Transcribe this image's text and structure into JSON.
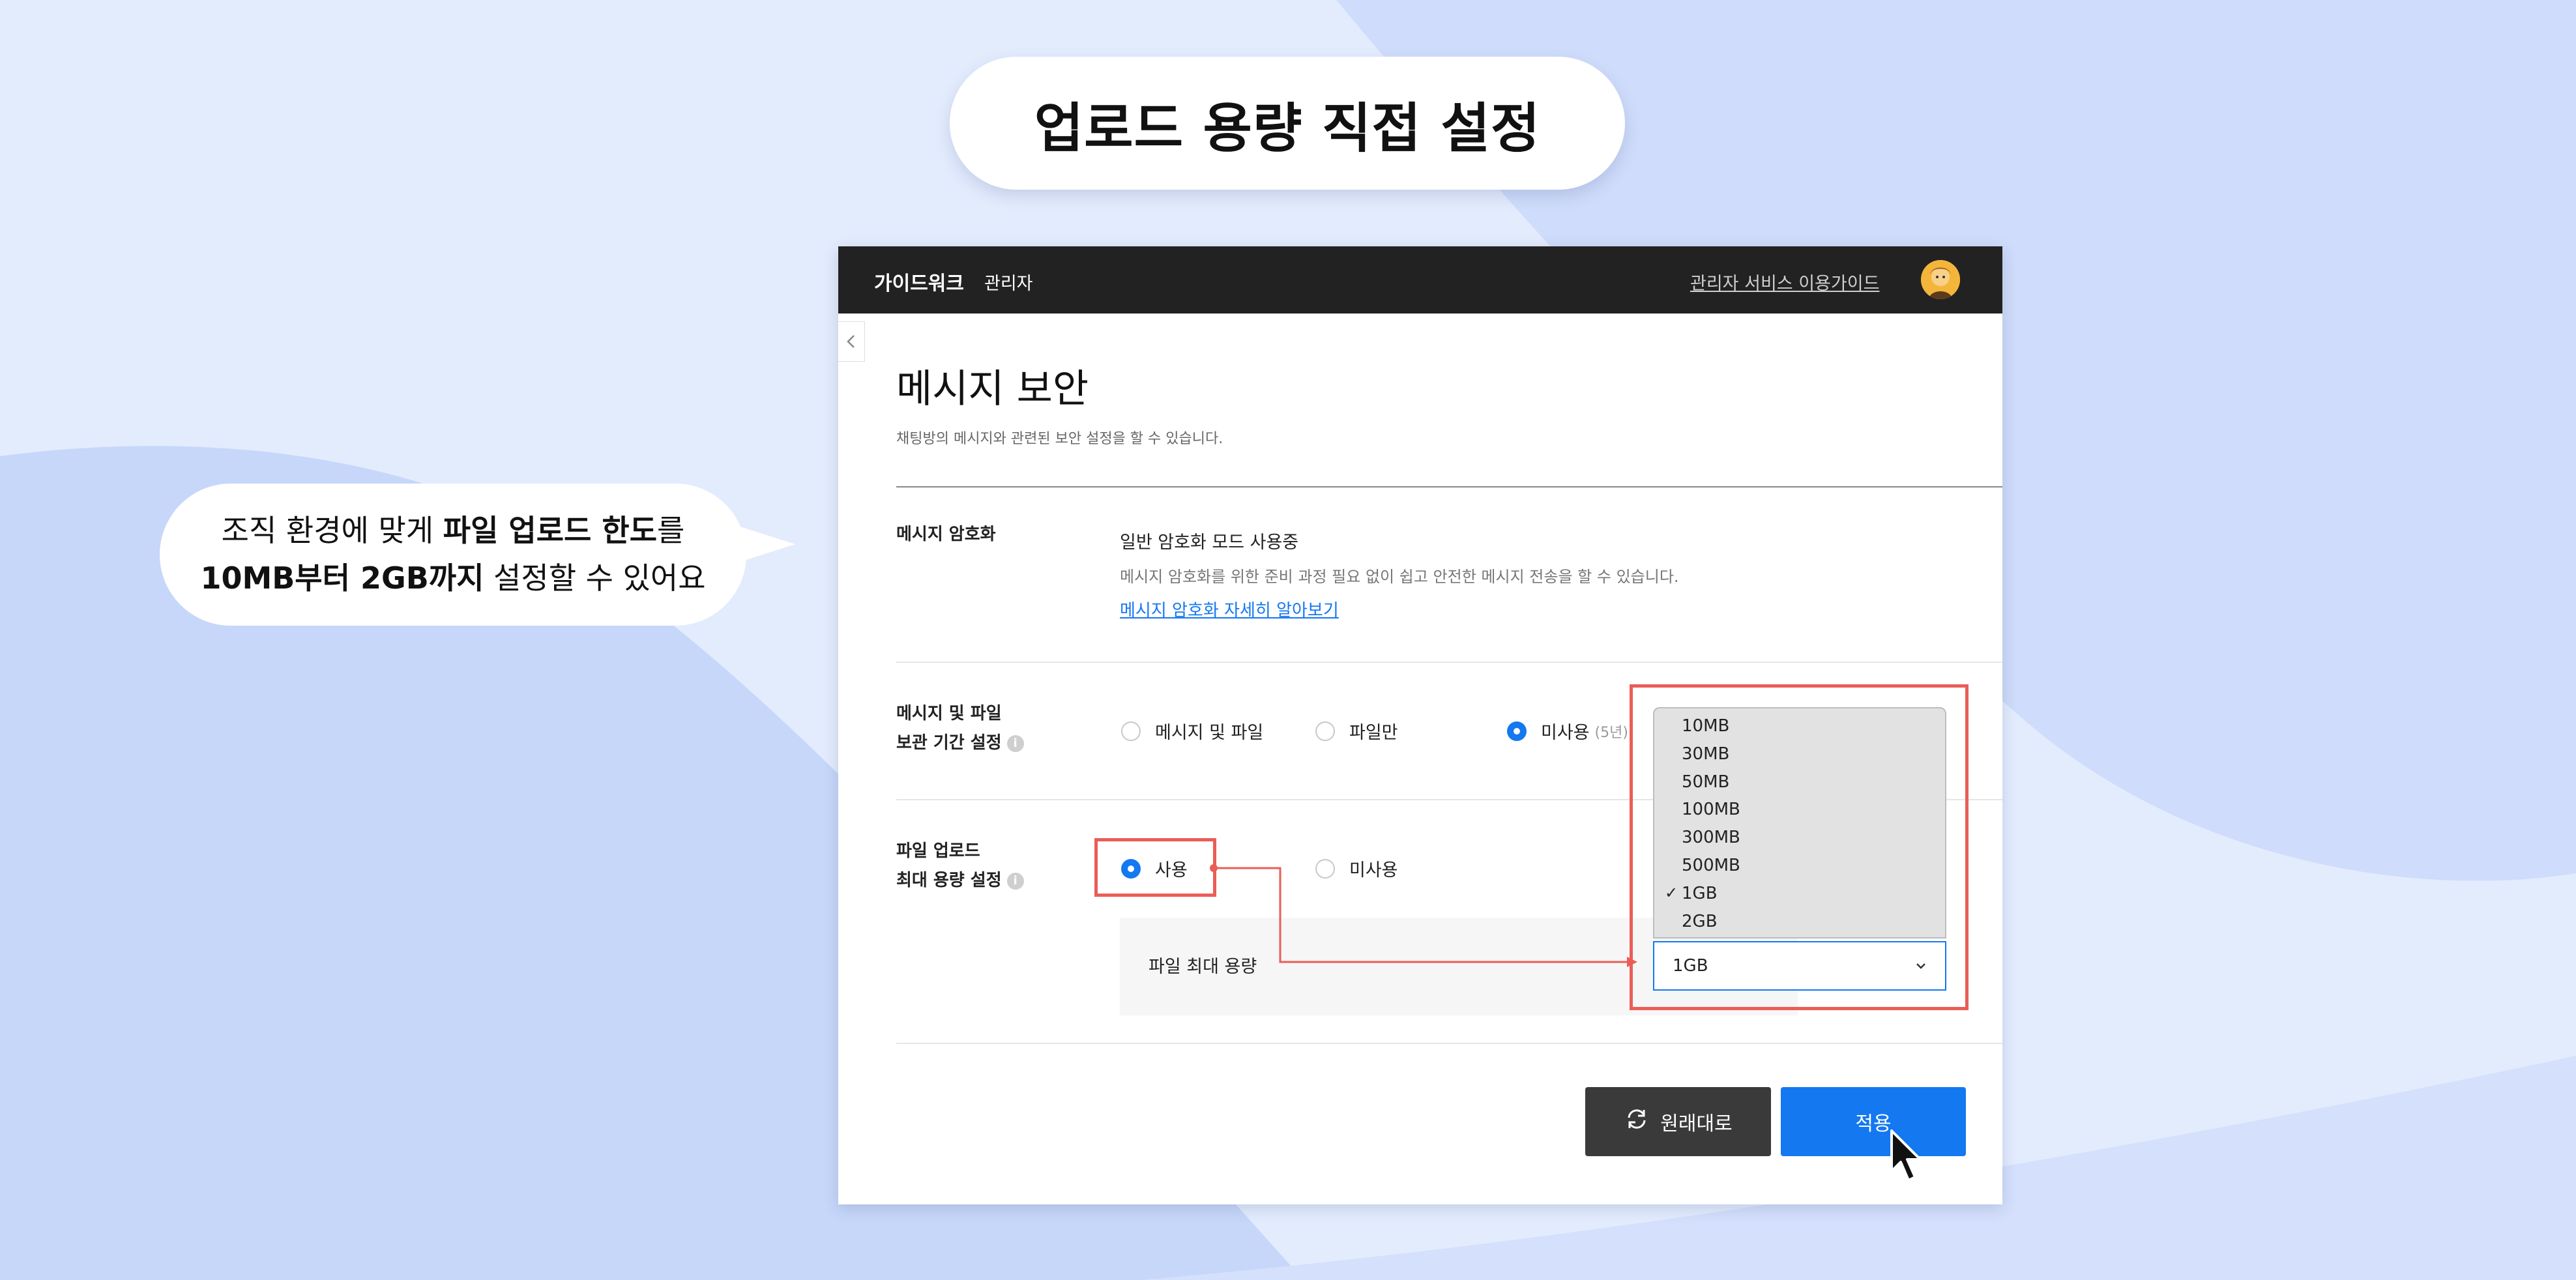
{
  "headline": "업로드 용량 직접 설정",
  "callout": {
    "line1_pre": "조직 환경에 맞게 ",
    "line1_bold": "파일 업로드 한도",
    "line1_post": "를",
    "line2_bold": "10MB부터 2GB까지",
    "line2_post": " 설정할 수 있어요"
  },
  "app": {
    "brand": "가이드워크",
    "admin_tag": "관리자",
    "guide_link": "관리자 서비스 이용가이드",
    "collapse_icon": "chevron-left-icon"
  },
  "page": {
    "title": "메시지 보안",
    "description": "채팅방의 메시지와 관련된 보안 설정을 할 수 있습니다."
  },
  "encryption": {
    "label": "메시지 암호화",
    "mode": "일반 암호화 모드 사용중",
    "description": "메시지 암호화를 위한 준비 과정 필요 없이 쉽고 안전한 메시지 전송을 할 수 있습니다.",
    "link": "메시지 암호화 자세히 알아보기"
  },
  "retention": {
    "label_line1": "메시지 및 파일",
    "label_line2": "보관 기간 설정",
    "info_icon": "i",
    "options": [
      {
        "label": "메시지 및 파일",
        "selected": false
      },
      {
        "label": "파일만",
        "selected": false
      },
      {
        "label": "미사용",
        "sub": "(5년)",
        "selected": true
      }
    ]
  },
  "upload": {
    "label_line1": "파일 업로드",
    "label_line2": "최대 용량 설정",
    "info_icon": "i",
    "options": [
      {
        "label": "사용",
        "selected": true
      },
      {
        "label": "미사용",
        "selected": false
      }
    ],
    "max_size_label": "파일 최대 용량",
    "selected_value": "1GB",
    "dropdown_options": [
      "10MB",
      "30MB",
      "50MB",
      "100MB",
      "300MB",
      "500MB",
      "1GB",
      "2GB"
    ],
    "checked_option": "1GB",
    "check_mark": "✓"
  },
  "actions": {
    "reset_label": "원래대로",
    "apply_label": "적용"
  },
  "colors": {
    "accent": "#1478f0",
    "highlight": "#ea5d57",
    "topbar": "#222222",
    "background": "#dfe9fc"
  }
}
